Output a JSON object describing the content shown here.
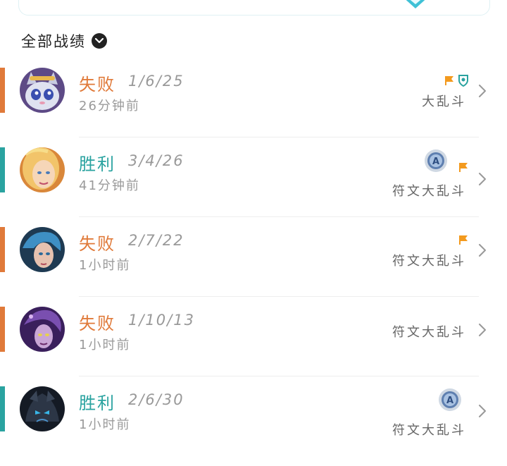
{
  "section": {
    "title": "全部战绩"
  },
  "colors": {
    "loss": "#e07a3a",
    "win": "#2aa3a0",
    "badge_orange": "#f39a1e",
    "badge_teal": "#2aa3a0"
  },
  "matches": [
    {
      "result": "失败",
      "kda": "1/6/25",
      "time": "26分钟前",
      "mode": "大乱斗",
      "badges": [
        "flag-icon",
        "shield-icon"
      ]
    },
    {
      "result": "胜利",
      "kda": "3/4/26",
      "time": "41分钟前",
      "mode": "符文大乱斗",
      "badges": [
        "a-medal-icon",
        "flag-icon"
      ]
    },
    {
      "result": "失败",
      "kda": "2/7/22",
      "time": "1小时前",
      "mode": "符文大乱斗",
      "badges": [
        "flag-icon"
      ]
    },
    {
      "result": "失败",
      "kda": "1/10/13",
      "time": "1小时前",
      "mode": "符文大乱斗",
      "badges": []
    },
    {
      "result": "胜利",
      "kda": "2/6/30",
      "time": "1小时前",
      "mode": "符文大乱斗",
      "badges": [
        "a-medal-icon"
      ]
    }
  ]
}
